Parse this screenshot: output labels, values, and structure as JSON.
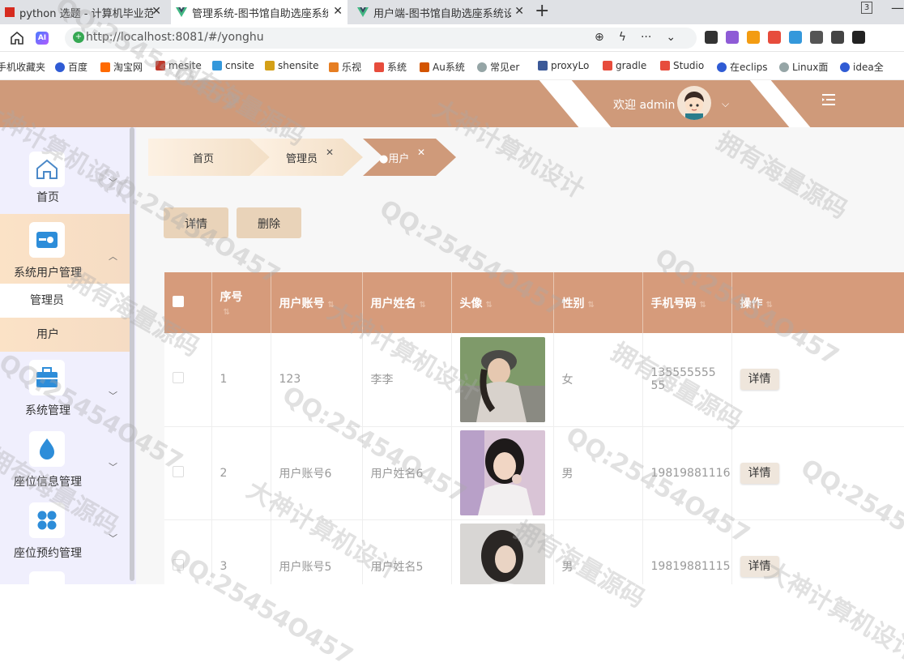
{
  "browser": {
    "tabs": [
      {
        "title": "python 选题 - 计算机毕业范例"
      },
      {
        "title": "管理系统-图书馆自助选座系统"
      },
      {
        "title": "用户端-图书馆自助选座系统设"
      }
    ],
    "tab_count": "3",
    "url": "http://localhost:8081/#/yonghu",
    "bookmarks": [
      {
        "label": "手机收藏夹",
        "color": "#ffffff"
      },
      {
        "label": "百度",
        "color": "#2f5bd4"
      },
      {
        "label": "淘宝网",
        "color": "#ff6a00"
      },
      {
        "label": "mesite",
        "color": "#c0392b"
      },
      {
        "label": "cnsite",
        "color": "#3498db"
      },
      {
        "label": "shensite",
        "color": "#d4a017"
      },
      {
        "label": "乐视",
        "color": "#e67e22"
      },
      {
        "label": "系统",
        "color": "#e74c3c"
      },
      {
        "label": "Au系统",
        "color": "#d35400"
      },
      {
        "label": "常见er",
        "color": "#95a5a6"
      },
      {
        "label": "proxyLo",
        "color": "#3b5998"
      },
      {
        "label": "gradle",
        "color": "#e74c3c"
      },
      {
        "label": "Studio",
        "color": "#e74c3c"
      },
      {
        "label": "在eclips",
        "color": "#2f5bd4"
      },
      {
        "label": "Linux面",
        "color": "#95a5a6"
      },
      {
        "label": "idea全",
        "color": "#2f5bd4"
      }
    ]
  },
  "header": {
    "welcome": "欢迎 admin"
  },
  "sidebar": {
    "items": [
      {
        "label": "首页",
        "icon": "home-icon"
      },
      {
        "label": "系统用户管理",
        "icon": "user-card-icon"
      },
      {
        "label": "系统管理",
        "icon": "toolbox-icon"
      },
      {
        "label": "座位信息管理",
        "icon": "drop-icon"
      },
      {
        "label": "座位预约管理",
        "icon": "grid-icon"
      }
    ],
    "sub_items": [
      {
        "label": "管理员"
      },
      {
        "label": "用户"
      }
    ]
  },
  "breadcrumbs": [
    {
      "label": "首页"
    },
    {
      "label": "管理员"
    },
    {
      "label": "●用户"
    }
  ],
  "toolbar": {
    "detail_label": "详情",
    "delete_label": "删除"
  },
  "table": {
    "headers": [
      "序号",
      "用户账号",
      "用户姓名",
      "头像",
      "性别",
      "手机号码",
      "操作"
    ],
    "rows": [
      {
        "index": "1",
        "account": "123",
        "name": "李李",
        "gender": "女",
        "phone": "13555555555",
        "action": "详情"
      },
      {
        "index": "2",
        "account": "用户账号6",
        "name": "用户姓名6",
        "gender": "男",
        "phone": "19819881116",
        "action": "详情"
      },
      {
        "index": "3",
        "account": "用户账号5",
        "name": "用户姓名5",
        "gender": "男",
        "phone": "19819881115",
        "action": "详情"
      }
    ]
  },
  "watermarks": [
    "QQ:25454O457",
    "拥有海量源码",
    "大神计算机设计"
  ],
  "colors": {
    "accent": "#cf9a7a",
    "table_header": "#d69b7b",
    "button": "#e9d3b9",
    "sidebar_bg": "#f0effd"
  }
}
